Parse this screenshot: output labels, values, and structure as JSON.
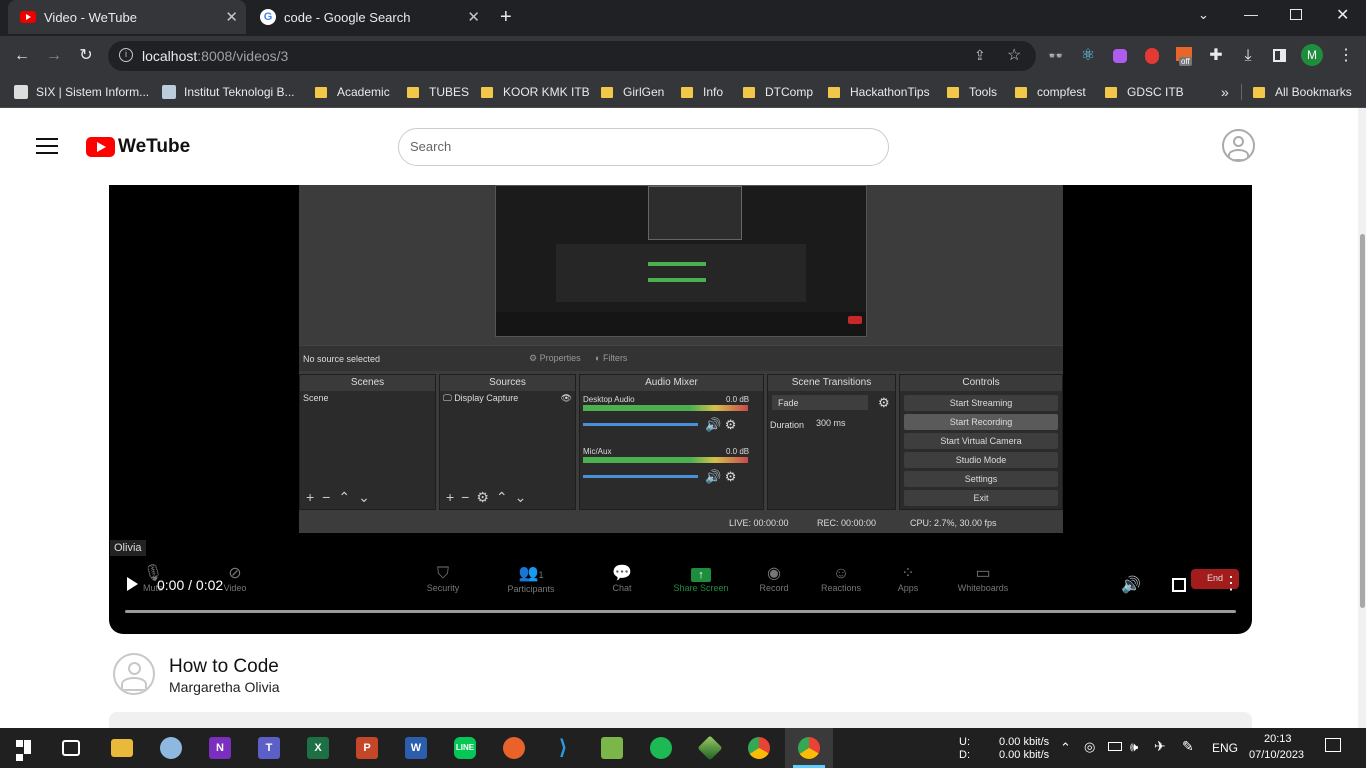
{
  "browser": {
    "tabs": [
      {
        "title": "Video - WeTube",
        "active": true
      },
      {
        "title": "code - Google Search",
        "active": false
      }
    ],
    "url_host": "localhost",
    "url_rest": ":8008/videos/3",
    "profile_letter": "M",
    "ext_off_badge": "off",
    "bookmarks": [
      {
        "label": "SIX | Sistem Inform...",
        "type": "site"
      },
      {
        "label": "Institut Teknologi B...",
        "type": "site"
      },
      {
        "label": "Academic",
        "type": "folder"
      },
      {
        "label": "TUBES",
        "type": "folder"
      },
      {
        "label": "KOOR KMK ITB",
        "type": "folder"
      },
      {
        "label": "GirlGen",
        "type": "folder"
      },
      {
        "label": "Info",
        "type": "folder"
      },
      {
        "label": "DTComp",
        "type": "folder"
      },
      {
        "label": "HackathonTips",
        "type": "folder"
      },
      {
        "label": "Tools",
        "type": "folder"
      },
      {
        "label": "compfest",
        "type": "folder"
      },
      {
        "label": "GDSC ITB",
        "type": "folder"
      }
    ],
    "more_bookmarks": "»",
    "all_bookmarks": "All Bookmarks"
  },
  "site": {
    "logo_text": "WeTube",
    "search_placeholder": "Search"
  },
  "video": {
    "time": "0:00 / 0:02",
    "progress": 0.0,
    "participant_label": "Olivia",
    "obs": {
      "no_source": "No source selected",
      "properties": "Properties",
      "filters": "Filters",
      "panels": {
        "scenes": "Scenes",
        "sources": "Sources",
        "audio": "Audio Mixer",
        "transitions": "Scene Transitions",
        "controls": "Controls"
      },
      "scene_item": "Scene",
      "source_item": "Display Capture",
      "audio": [
        {
          "name": "Desktop Audio",
          "db": "0.0 dB"
        },
        {
          "name": "Mic/Aux",
          "db": "0.0 dB"
        }
      ],
      "transition": "Fade",
      "duration_label": "Duration",
      "duration_value": "300 ms",
      "controls": [
        "Start Streaming",
        "Start Recording",
        "Start Virtual Camera",
        "Studio Mode",
        "Settings",
        "Exit"
      ],
      "status_live": "LIVE: 00:00:00",
      "status_rec": "REC: 00:00:00",
      "status_cpu": "CPU: 2.7%, 30.00 fps"
    },
    "zoom_bar": [
      {
        "label": "Mute",
        "icon": "mic-icon"
      },
      {
        "label": "Video",
        "icon": "camera-off-icon"
      },
      {
        "label": "Security",
        "icon": "shield-icon"
      },
      {
        "label": "Participants",
        "icon": "people-icon",
        "count": "1"
      },
      {
        "label": "Chat",
        "icon": "chat-icon"
      },
      {
        "label": "Share Screen",
        "icon": "share-screen-icon"
      },
      {
        "label": "Record",
        "icon": "record-icon"
      },
      {
        "label": "Reactions",
        "icon": "reactions-icon"
      },
      {
        "label": "Apps",
        "icon": "apps-icon"
      },
      {
        "label": "Whiteboards",
        "icon": "whiteboard-icon"
      }
    ],
    "zoom_end": "End"
  },
  "video_info": {
    "title": "How to Code",
    "channel": "Margaretha Olivia"
  },
  "taskbar": {
    "net_up_label": "U:",
    "net_down_label": "D:",
    "net_up": "0.00 kbit/s",
    "net_down": "0.00 kbit/s",
    "lang": "ENG",
    "time": "20:13",
    "date": "07/10/2023"
  }
}
